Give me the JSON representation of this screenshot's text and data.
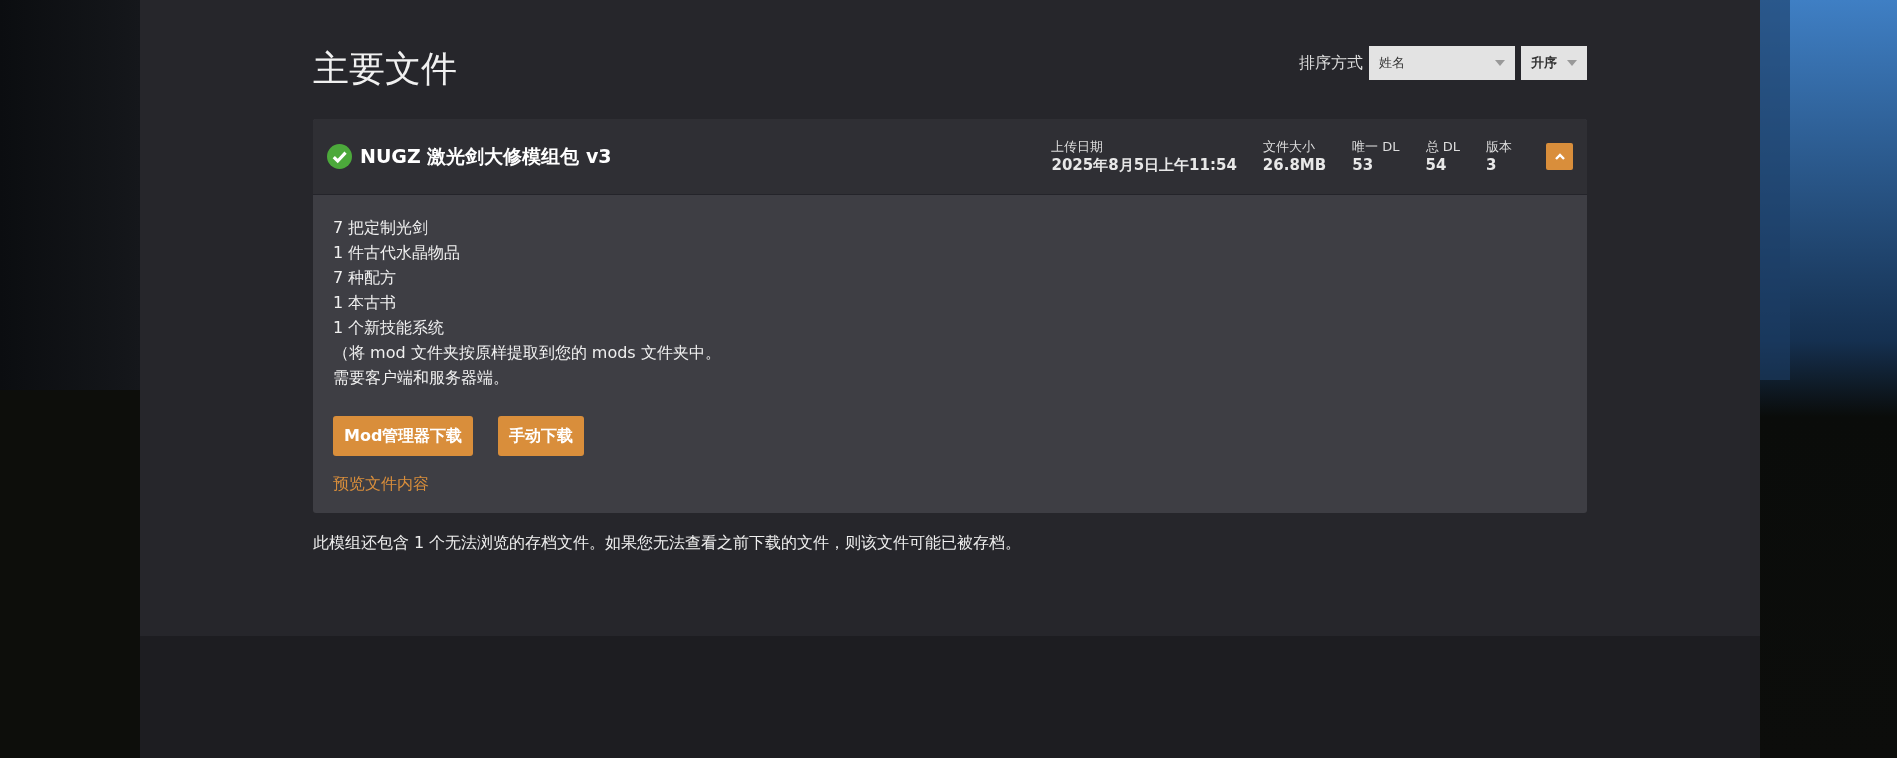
{
  "title": "主要文件",
  "sort": {
    "label": "排序方式",
    "field": "姓名",
    "order": "升序"
  },
  "file": {
    "name": "NUGZ 激光剑大修模组包 v3",
    "expanded": true,
    "stats": [
      {
        "label": "上传日期",
        "value": "2025年8月5日上午11:54"
      },
      {
        "label": "文件大小",
        "value": "26.8MB"
      },
      {
        "label": "唯一 DL",
        "value": "53"
      },
      {
        "label": "总 DL",
        "value": "54"
      },
      {
        "label": "版本",
        "value": "3"
      }
    ],
    "description": [
      "7 把定制光剑",
      "1 件古代水晶物品",
      "7 种配方",
      "1 本古书",
      "1 个新技能系统",
      "（将 mod 文件夹按原样提取到您的 mods 文件夹中。",
      "需要客户端和服务器端。"
    ],
    "buttons": [
      "Mod管理器下载",
      "手动下载"
    ],
    "preview_link": "预览文件内容"
  },
  "archive_note": "此模组还包含 1 个无法浏览的存档文件。如果您无法查看之前下载的文件，则该文件可能已被存档。"
}
